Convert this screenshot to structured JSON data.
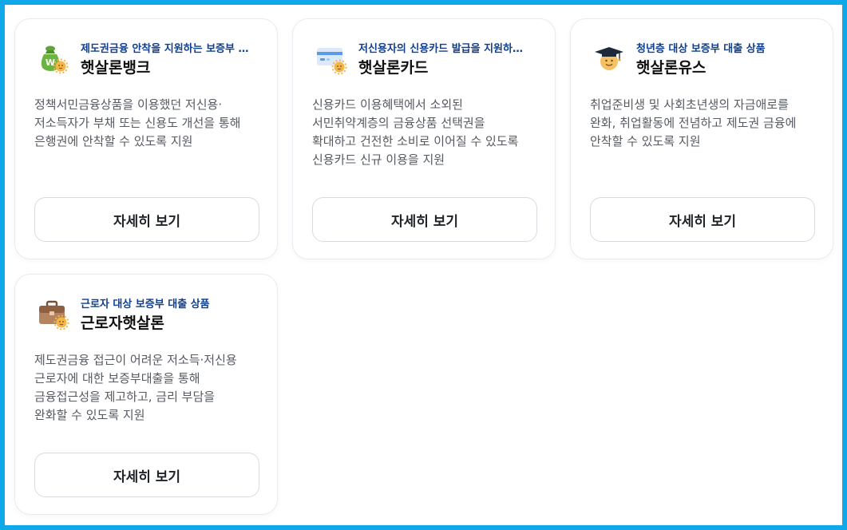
{
  "cards": [
    {
      "icon": "money-bag-sun-icon",
      "tag": "제도권금융 안착을 지원하는 보증부 …",
      "name": "햇살론뱅크",
      "desc": [
        "정책서민금융상품을 이용했던 저신용·",
        "저소득자가 부채 또는 신용도 개선을 통해",
        "은행권에 안착할 수 있도록 지원"
      ],
      "button": "자세히 보기"
    },
    {
      "icon": "credit-card-sun-icon",
      "tag": "저신용자의 신용카드 발급을 지원하…",
      "name": "햇살론카드",
      "desc": [
        "신용카드 이용혜택에서 소외된",
        "서민취약계층의 금융상품 선택권을",
        "확대하고 건전한 소비로 이어질 수 있도록",
        "신용카드 신규 이용을 지원"
      ],
      "button": "자세히 보기"
    },
    {
      "icon": "graduation-cap-face-icon",
      "tag": "청년층 대상 보증부 대출 상품",
      "name": "햇살론유스",
      "desc": [
        "취업준비생 및 사회초년생의 자금애로를",
        "완화, 취업활동에 전념하고 제도권 금융에",
        "안착할 수 있도록 지원"
      ],
      "button": "자세히 보기"
    },
    {
      "icon": "briefcase-sun-icon",
      "tag": "근로자 대상 보증부 대출 상품",
      "name": "근로자햇살론",
      "desc": [
        "제도권금융 접근이 어려운 저소득·저신용",
        "근로자에 대한 보증부대출을 통해",
        "금융접근성을 제고하고, 금리 부담을",
        "완화할 수 있도록 지원"
      ],
      "button": "자세히 보기"
    }
  ]
}
